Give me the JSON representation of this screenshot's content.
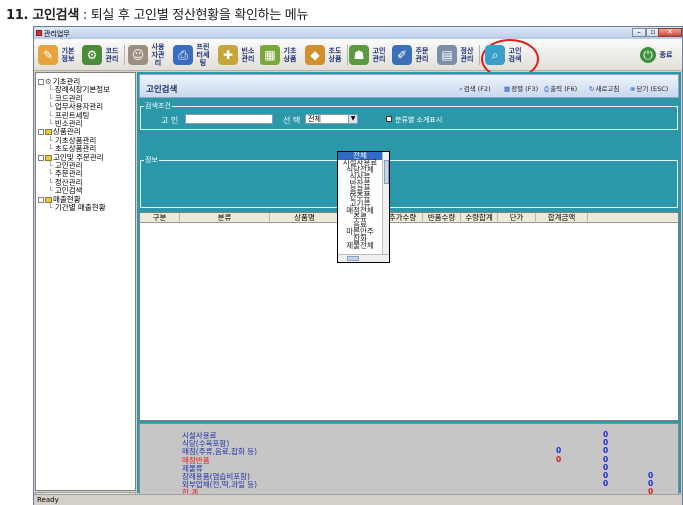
{
  "doc_heading": {
    "number": "11. 고인검색",
    "separator": " : ",
    "description": "퇴실 후 고인별 정산현황을 확인하는 메뉴"
  },
  "window": {
    "title": "관리업무",
    "minimize": "–",
    "maximize": "▫",
    "close": "✕"
  },
  "toolbar": {
    "items": [
      {
        "label": "기본정보",
        "color": "#e8a33c",
        "glyph": "✎"
      },
      {
        "label": "코드관리",
        "color": "#4c8b3a",
        "glyph": "⚙"
      },
      {
        "label": "사용자관리",
        "color": "#9a8f80",
        "glyph": "☺"
      },
      {
        "label": "프린터세팅",
        "color": "#3a6dc2",
        "glyph": "⎙"
      },
      {
        "label": "빈소관리",
        "color": "#c6a53b",
        "glyph": "✚"
      },
      {
        "label": "기초상품",
        "color": "#7ba83a",
        "glyph": "▦"
      },
      {
        "label": "초도상품",
        "color": "#d28f2e",
        "glyph": "◆"
      },
      {
        "label": "고인관리",
        "color": "#5a9a43",
        "glyph": "☗"
      },
      {
        "label": "주문관리",
        "color": "#3b6fb6",
        "glyph": "✐"
      },
      {
        "label": "정산관리",
        "color": "#7d8fa8",
        "glyph": "▤"
      },
      {
        "label": "고인검색",
        "color": "#3aa0c9",
        "glyph": "⌕"
      }
    ],
    "exit_label": "종료",
    "exit_color": "#3b8f3b"
  },
  "tree": {
    "items": [
      {
        "label": "기초관리",
        "type": "root"
      },
      {
        "label": "장례식장기본정보",
        "type": "leaf"
      },
      {
        "label": "코드관리",
        "type": "leaf"
      },
      {
        "label": "업무사용자관리",
        "type": "leaf"
      },
      {
        "label": "프린트세팅",
        "type": "leaf"
      },
      {
        "label": "빈소관리",
        "type": "leaf"
      },
      {
        "label": "상품관리",
        "type": "folder"
      },
      {
        "label": "기초상품관리",
        "type": "leaf"
      },
      {
        "label": "초도상품관리",
        "type": "leaf"
      },
      {
        "label": "고인및 주문관리",
        "type": "folder"
      },
      {
        "label": "고인관리",
        "type": "leaf"
      },
      {
        "label": "주문관리",
        "type": "leaf"
      },
      {
        "label": "정산관리",
        "type": "leaf"
      },
      {
        "label": "고인검색",
        "type": "leaf"
      },
      {
        "label": "매출현황",
        "type": "folder"
      },
      {
        "label": "기간별 매출현황",
        "type": "leaf"
      }
    ]
  },
  "header": {
    "title": "고인검색",
    "buttons": [
      {
        "icon": "⌕",
        "label": "검색 (F2)"
      },
      {
        "icon": "▦",
        "label": "정렬 (F3)"
      },
      {
        "icon": "⎙",
        "label": "출력 (F6)"
      },
      {
        "icon": "↻",
        "label": "새로고침"
      },
      {
        "icon": "⊗",
        "label": "닫기 (ESC)"
      }
    ]
  },
  "search": {
    "group_title": "검색조건",
    "name_label": "고 인",
    "name_value": "",
    "select_label": "선 택",
    "select_value": "전체",
    "checkbox_label": "분류별 소계표시"
  },
  "info": {
    "group_title": "정보"
  },
  "grid": {
    "columns": [
      "구분",
      "분류",
      "상품명",
      "초도수량",
      "추가수량",
      "반품수량",
      "수량합계",
      "단가",
      "합계금액"
    ]
  },
  "dropdown": {
    "options": [
      "전체",
      "시설사용료",
      "식당전체",
      "식사류",
      "반찬류",
      "음료류",
      "안주류",
      "고기류",
      "매점전체",
      "주류",
      "음료",
      "마른안주",
      "잡화",
      "제물전체"
    ],
    "selected_index": 0
  },
  "summary": {
    "rows": [
      {
        "label": "시설사용료",
        "values": [
          "0",
          ""
        ],
        "red": false
      },
      {
        "label": "식당(수육포함)",
        "values": [
          "0",
          ""
        ],
        "red": false
      },
      {
        "label": "매점(주류,음료,잡화 등)",
        "values": [
          "0",
          "",
          "0"
        ],
        "red": false
      },
      {
        "label": "매점반품",
        "values": [
          "0",
          "",
          "0"
        ],
        "red": true
      },
      {
        "label": "제물류",
        "values": [
          "0",
          ""
        ],
        "red": false
      },
      {
        "label": "장례용품(염습비포함)",
        "values": [
          "0",
          "0"
        ],
        "red": false
      },
      {
        "label": "외부업체(전,떡,과일 등)",
        "values": [
          "0",
          "0"
        ],
        "red": false
      },
      {
        "label": "합        계",
        "values": [
          "",
          "0"
        ],
        "red": true
      }
    ]
  },
  "statusbar": {
    "text": "Ready"
  },
  "colors": {
    "content_bg": "#2a98a8",
    "highlight_circle": "#e41d1d",
    "summary_value": "#1a2cd6"
  }
}
